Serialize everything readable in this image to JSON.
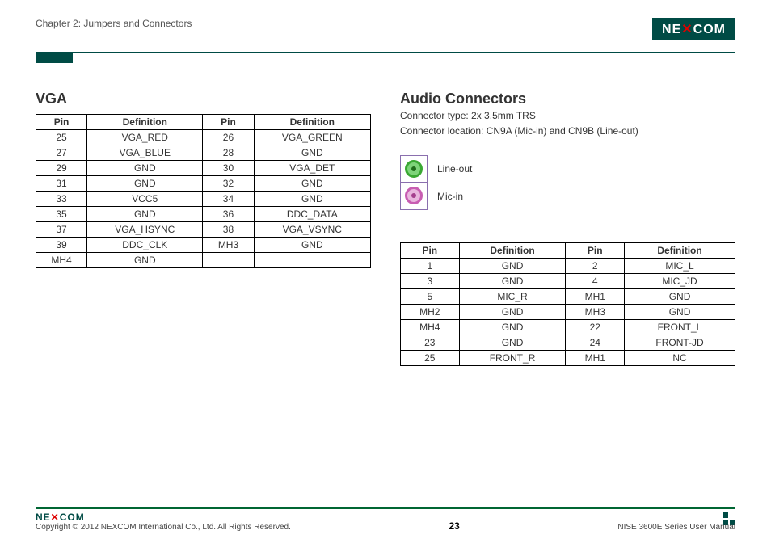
{
  "header": {
    "chapter": "Chapter 2: Jumpers and Connectors",
    "logoText": "NEXCOM"
  },
  "vga": {
    "title": "VGA",
    "headers": [
      "Pin",
      "Definition",
      "Pin",
      "Definition"
    ],
    "rows": [
      [
        "25",
        "VGA_RED",
        "26",
        "VGA_GREEN"
      ],
      [
        "27",
        "VGA_BLUE",
        "28",
        "GND"
      ],
      [
        "29",
        "GND",
        "30",
        "VGA_DET"
      ],
      [
        "31",
        "GND",
        "32",
        "GND"
      ],
      [
        "33",
        "VCC5",
        "34",
        "GND"
      ],
      [
        "35",
        "GND",
        "36",
        "DDC_DATA"
      ],
      [
        "37",
        "VGA_HSYNC",
        "38",
        "VGA_VSYNC"
      ],
      [
        "39",
        "DDC_CLK",
        "MH3",
        "GND"
      ],
      [
        "MH4",
        "GND",
        "",
        ""
      ]
    ]
  },
  "audio": {
    "title": "Audio Connectors",
    "line1": "Connector type: 2x 3.5mm TRS",
    "line2": "Connector location: CN9A (Mic-in) and CN9B (Line-out)",
    "jacks": {
      "lineout": "Line-out",
      "micin": "Mic-in"
    },
    "headers": [
      "Pin",
      "Definition",
      "Pin",
      "Definition"
    ],
    "rows": [
      [
        "1",
        "GND",
        "2",
        "MIC_L"
      ],
      [
        "3",
        "GND",
        "4",
        "MIC_JD"
      ],
      [
        "5",
        "MIC_R",
        "MH1",
        "GND"
      ],
      [
        "MH2",
        "GND",
        "MH3",
        "GND"
      ],
      [
        "MH4",
        "GND",
        "22",
        "FRONT_L"
      ],
      [
        "23",
        "GND",
        "24",
        "FRONT-JD"
      ],
      [
        "25",
        "FRONT_R",
        "MH1",
        "NC"
      ]
    ]
  },
  "footer": {
    "logo": "NEXCOM",
    "copyright": "Copyright © 2012 NEXCOM International Co., Ltd. All Rights Reserved.",
    "page": "23",
    "manual": "NISE 3600E Series User Manual"
  }
}
